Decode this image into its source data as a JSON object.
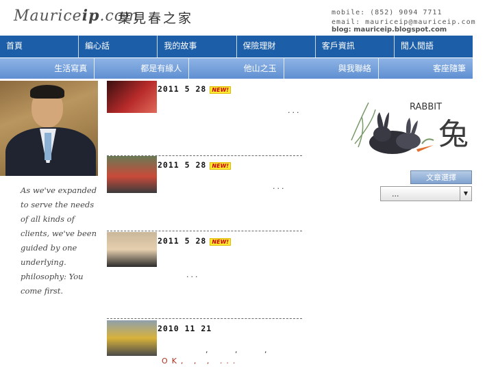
{
  "header": {
    "logo_prefix": "Maurice",
    "logo_ip": "ip",
    "logo_suffix": ".com",
    "logo_cn": "葉見春之家",
    "mobile": "mobile: (852) 9094 7711",
    "email": "email: mauriceip@mauriceip.com",
    "blog": "blog: mauriceip.blogspot.com"
  },
  "nav_primary": [
    {
      "label": "首頁"
    },
    {
      "label": "編心話"
    },
    {
      "label": "我的故事"
    },
    {
      "label": "保險理財"
    },
    {
      "label": "客戶資訊"
    },
    {
      "label": "閒人閒語"
    }
  ],
  "nav_secondary": [
    {
      "label": "生活寫真"
    },
    {
      "label": "都是有緣人"
    },
    {
      "label": "他山之玉"
    },
    {
      "label": "與我聯絡"
    },
    {
      "label": "客座隨筆"
    }
  ],
  "sidebar": {
    "quote": "As we've expanded to serve the needs of all kinds of clients, we've been guided by one underlying. philosophy: You come first."
  },
  "posts": [
    {
      "date": "2011 5 28",
      "new_badge": "NEW!",
      "excerpt": "..."
    },
    {
      "date": "2011 5 28",
      "new_badge": "NEW!",
      "excerpt": "..."
    },
    {
      "date": "2011 5 28",
      "new_badge": "NEW!",
      "excerpt": "..."
    },
    {
      "date": "2010 11 21",
      "excerpt_line1": ", , ,",
      "excerpt_line2": "OK, , , ..."
    }
  ],
  "right_panel": {
    "rabbit_title": "RABBIT",
    "rabbit_char": "兔",
    "article_button": "文章選擇",
    "select_value": "..."
  },
  "colors": {
    "nav_primary_bg": "#1d5ea8",
    "nav_secondary_bg": "#6f9bd8",
    "new_badge_bg": "#ffeb33"
  }
}
